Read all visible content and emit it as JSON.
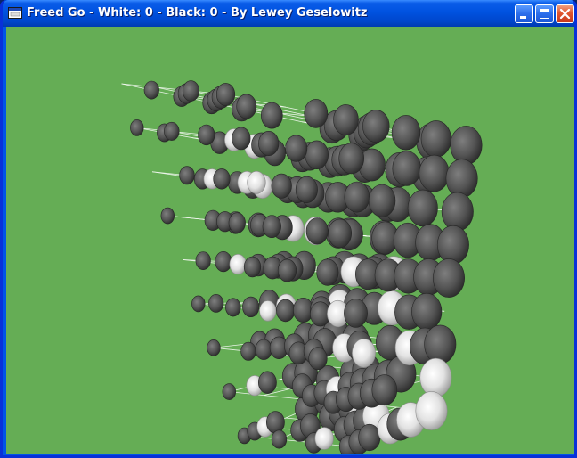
{
  "window": {
    "title": "Freed Go - White: 0 - Black: 0 - By Lewey Geselowitz",
    "titlebar_color": "#0A5CE8",
    "controls": [
      "minimize-icon",
      "maximize-icon",
      "close-icon"
    ]
  },
  "game": {
    "background_color": "#65AD55",
    "white_stone_color": "#E8E8E8",
    "black_stone_color": "#555555",
    "score": {
      "white": 0,
      "black": 0
    },
    "board_view": "3d-perspective-grid"
  }
}
